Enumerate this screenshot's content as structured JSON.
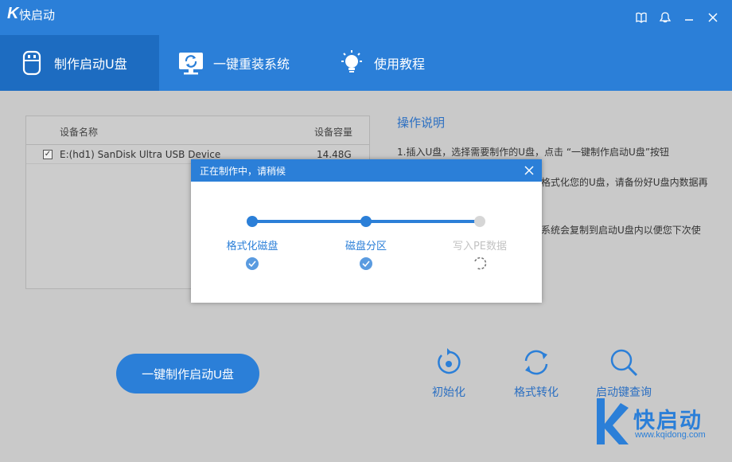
{
  "app": {
    "logo": "K",
    "title": "快启动"
  },
  "window_controls": [
    "book-icon",
    "skin-icon",
    "minimize-icon",
    "close-icon"
  ],
  "nav": {
    "tabs": [
      {
        "label": "制作启动U盘",
        "icon": "usb-icon",
        "active": true
      },
      {
        "label": "一键重装系统",
        "icon": "monitor-refresh-icon",
        "active": false
      },
      {
        "label": "使用教程",
        "icon": "lightbulb-icon",
        "active": false
      }
    ]
  },
  "device_table": {
    "headers": {
      "name": "设备名称",
      "size": "设备容量"
    },
    "rows": [
      {
        "checked": true,
        "name": "E:(hd1) SanDisk Ultra USB Device",
        "size": "14.48G"
      }
    ]
  },
  "help": {
    "title": "操作说明",
    "line1": "1.插入U盘，选择需要制作的U盘，点击 “一键制作启动U盘”按钮",
    "line2": "格式化您的U盘，请备份好U盘内数据再",
    "line3": "系统会复制到启动U盘内以便您下次使"
  },
  "actions": {
    "make_label": "一键制作启动U盘",
    "tools": [
      {
        "label": "初始化",
        "icon": "reset-icon"
      },
      {
        "label": "格式转化",
        "icon": "convert-icon"
      },
      {
        "label": "启动键查询",
        "icon": "search-icon"
      }
    ]
  },
  "watermark": {
    "text": "快启动",
    "url": "www.kqidong.com"
  },
  "dialog": {
    "title": "正在制作中，请稍候",
    "steps": [
      {
        "label": "格式化磁盘",
        "status": "done"
      },
      {
        "label": "磁盘分区",
        "status": "done"
      },
      {
        "label": "写入PE数据",
        "status": "in-progress"
      }
    ]
  },
  "colors": {
    "primary": "#2b7fd8",
    "active_tab": "#1d6cc1",
    "pending": "#c3c3c3",
    "background": "#c9c9c9"
  }
}
